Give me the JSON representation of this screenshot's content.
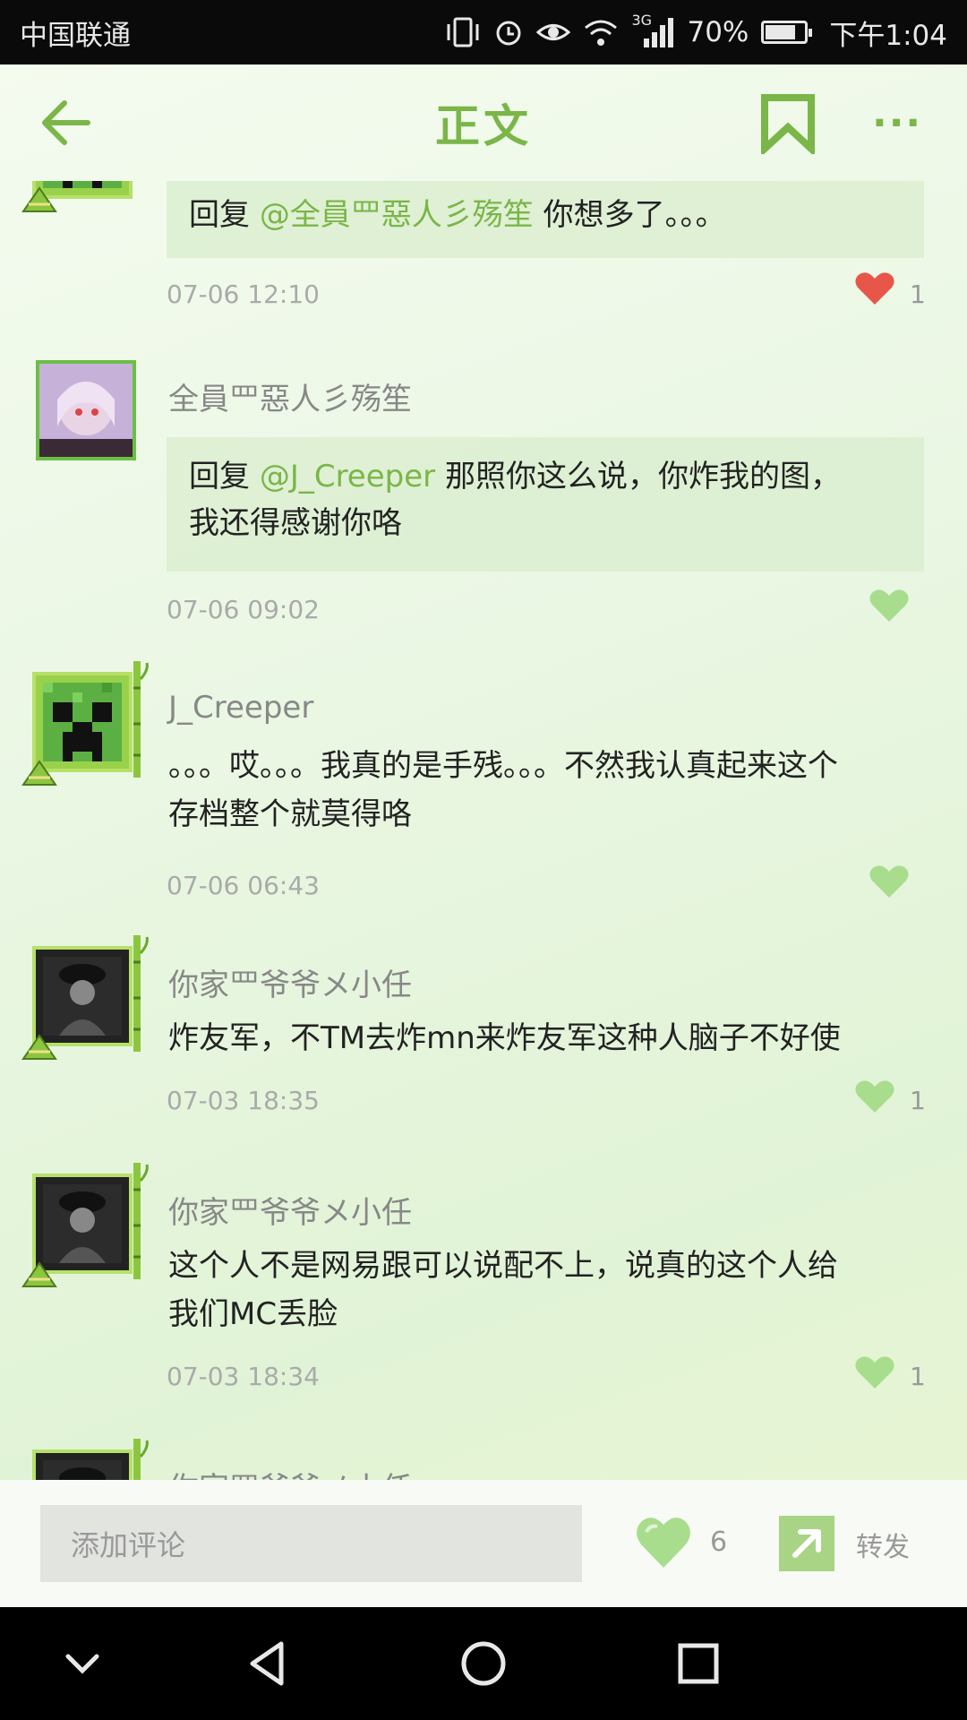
{
  "status_bar": {
    "carrier": "中国联通",
    "network_type": "3G",
    "battery": "70%",
    "time": "下午1:04",
    "icons": [
      "vibrate-icon",
      "alarm-icon",
      "eye-icon",
      "wifi-icon",
      "signal-icon",
      "battery-icon"
    ]
  },
  "header": {
    "title": "正文",
    "back_icon": "back-arrow-icon",
    "bookmark_icon": "bookmark-icon",
    "more_icon": "more-icon"
  },
  "comments": [
    {
      "reply_prefix": "回复",
      "mention": "@全員罒惡人彡殇笙",
      "text": "你想多了。。。",
      "time": "07-06 12:10",
      "likes": "1",
      "liked": true
    },
    {
      "username": "全員罒惡人彡殇笙",
      "reply_prefix": "回复",
      "mention": "@J_Creeper",
      "text_line1": "那照你这么说，你炸我的图，",
      "text_line2": "我还得感谢你咯",
      "time": "07-06 09:02",
      "likes": "",
      "liked": false
    },
    {
      "username": "J_Creeper",
      "text_line1": "。。。哎。。。我真的是手残。。。不然我认真起来这个",
      "text_line2": "存档整个就莫得咯",
      "time": "07-06 06:43",
      "likes": "",
      "liked": false
    },
    {
      "username": "你家罒爷爷メ小任",
      "text_line1": "炸友军，不TM去炸mn来炸友军这种人脑子不好使",
      "time": "07-03 18:35",
      "likes": "1",
      "liked": false
    },
    {
      "username": "你家罒爷爷メ小任",
      "text_line1": "这个人不是网易跟可以说配不上，说真的这个人给",
      "text_line2": "我们MC丢脸",
      "time": "07-03 18:34",
      "likes": "1",
      "liked": false
    },
    {
      "username": "你家罒爷爷メ小任"
    }
  ],
  "bottom_bar": {
    "comment_placeholder": "添加评论",
    "like_count": "6",
    "share_label": "转发"
  },
  "colors": {
    "accent": "#7ab648",
    "like_active": "#e8564a",
    "like_inactive": "#a8dd8e"
  }
}
